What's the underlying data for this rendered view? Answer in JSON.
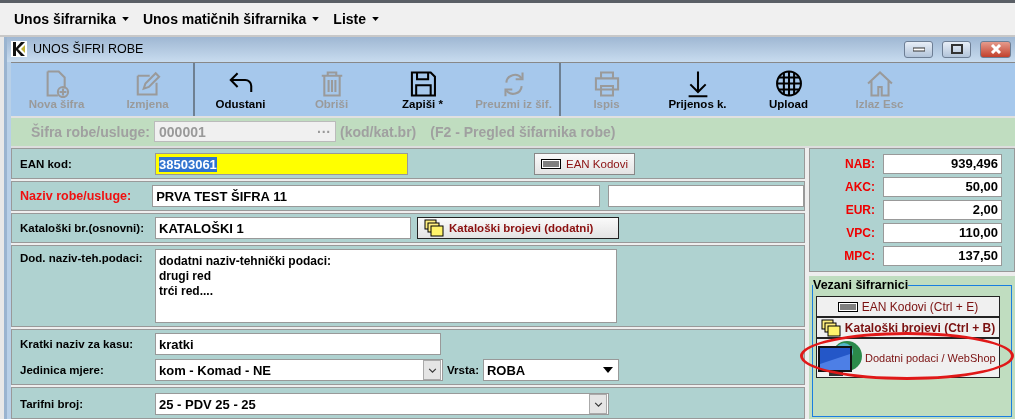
{
  "menu": [
    {
      "label": "Unos šifrarnika"
    },
    {
      "label": "Unos matičnih šifrarnika"
    },
    {
      "label": "Liste"
    }
  ],
  "window": {
    "title": "UNOS ŠIFRI ROBE"
  },
  "toolbar": {
    "groups": [
      [
        {
          "label": "Nova šifra",
          "kind": "new",
          "enabled": false
        },
        {
          "label": "Izmjena",
          "kind": "edit",
          "enabled": false
        }
      ],
      [
        {
          "label": "Odustani",
          "kind": "undo",
          "enabled": true
        },
        {
          "label": "Obriši",
          "kind": "trash",
          "enabled": false
        },
        {
          "label": "Zapiši *",
          "kind": "save",
          "enabled": true
        },
        {
          "label": "Preuzmi iz šif.",
          "kind": "refresh",
          "enabled": false
        }
      ],
      [
        {
          "label": "Ispis",
          "kind": "print",
          "enabled": false
        },
        {
          "label": "Prijenos k.",
          "kind": "download",
          "enabled": true
        },
        {
          "label": "Upload",
          "kind": "globe",
          "enabled": true
        },
        {
          "label": "Izlaz Esc",
          "kind": "home",
          "enabled": false
        }
      ]
    ]
  },
  "code_bar": {
    "label": "Šifra robe/usluge:",
    "value": "000001",
    "browse": "···",
    "hint": "(kod/kat.br)",
    "shortcut": "(F2 - Pregled šifarnika robe)",
    "disabled": true
  },
  "form": {
    "ean": {
      "label": "EAN kod:",
      "value": "38503061",
      "button": "EAN Kodovi"
    },
    "name": {
      "label": "Naziv robe/usluge:",
      "required": true,
      "value": "PRVA TEST ŠIFRA 11"
    },
    "catalog": {
      "label": "Kataloški br.(osnovni):",
      "value": "KATALOŠKI 1",
      "button": "Kataloški brojevi (dodatni)"
    },
    "extra": {
      "label": "Dod. naziv-teh.podaci:",
      "value": "dodatni naziv-tehnički podaci:\ndrugi red\ntrći red...."
    },
    "short_name": {
      "label": "Kratki naziv za kasu:",
      "value": "kratki"
    },
    "unit": {
      "label": "Jedinica mjere:",
      "value": "kom - Komad - NE"
    },
    "kind": {
      "label": "Vrsta:",
      "value": "ROBA"
    },
    "tariff": {
      "label": "Tarifni broj:",
      "value": "25 - PDV 25 - 25"
    }
  },
  "prices": [
    {
      "label": "NAB:",
      "value": "939,496"
    },
    {
      "label": "AKC:",
      "value": "50,00"
    },
    {
      "label": "EUR:",
      "value": "2,00"
    },
    {
      "label": "VPC:",
      "value": "110,00"
    },
    {
      "label": "MPC:",
      "value": "137,50"
    }
  ],
  "linked": {
    "title": "Vezani šifrarnici",
    "buttons": [
      {
        "label": "EAN Kodovi (Ctrl + E)",
        "kind": "barcode",
        "circled": false
      },
      {
        "label": "Kataloški brojevi (Ctrl + B)",
        "kind": "folders",
        "circled": false
      },
      {
        "label": "Dodatni podaci / WebShop",
        "kind": "monitor",
        "circled": true
      }
    ]
  }
}
